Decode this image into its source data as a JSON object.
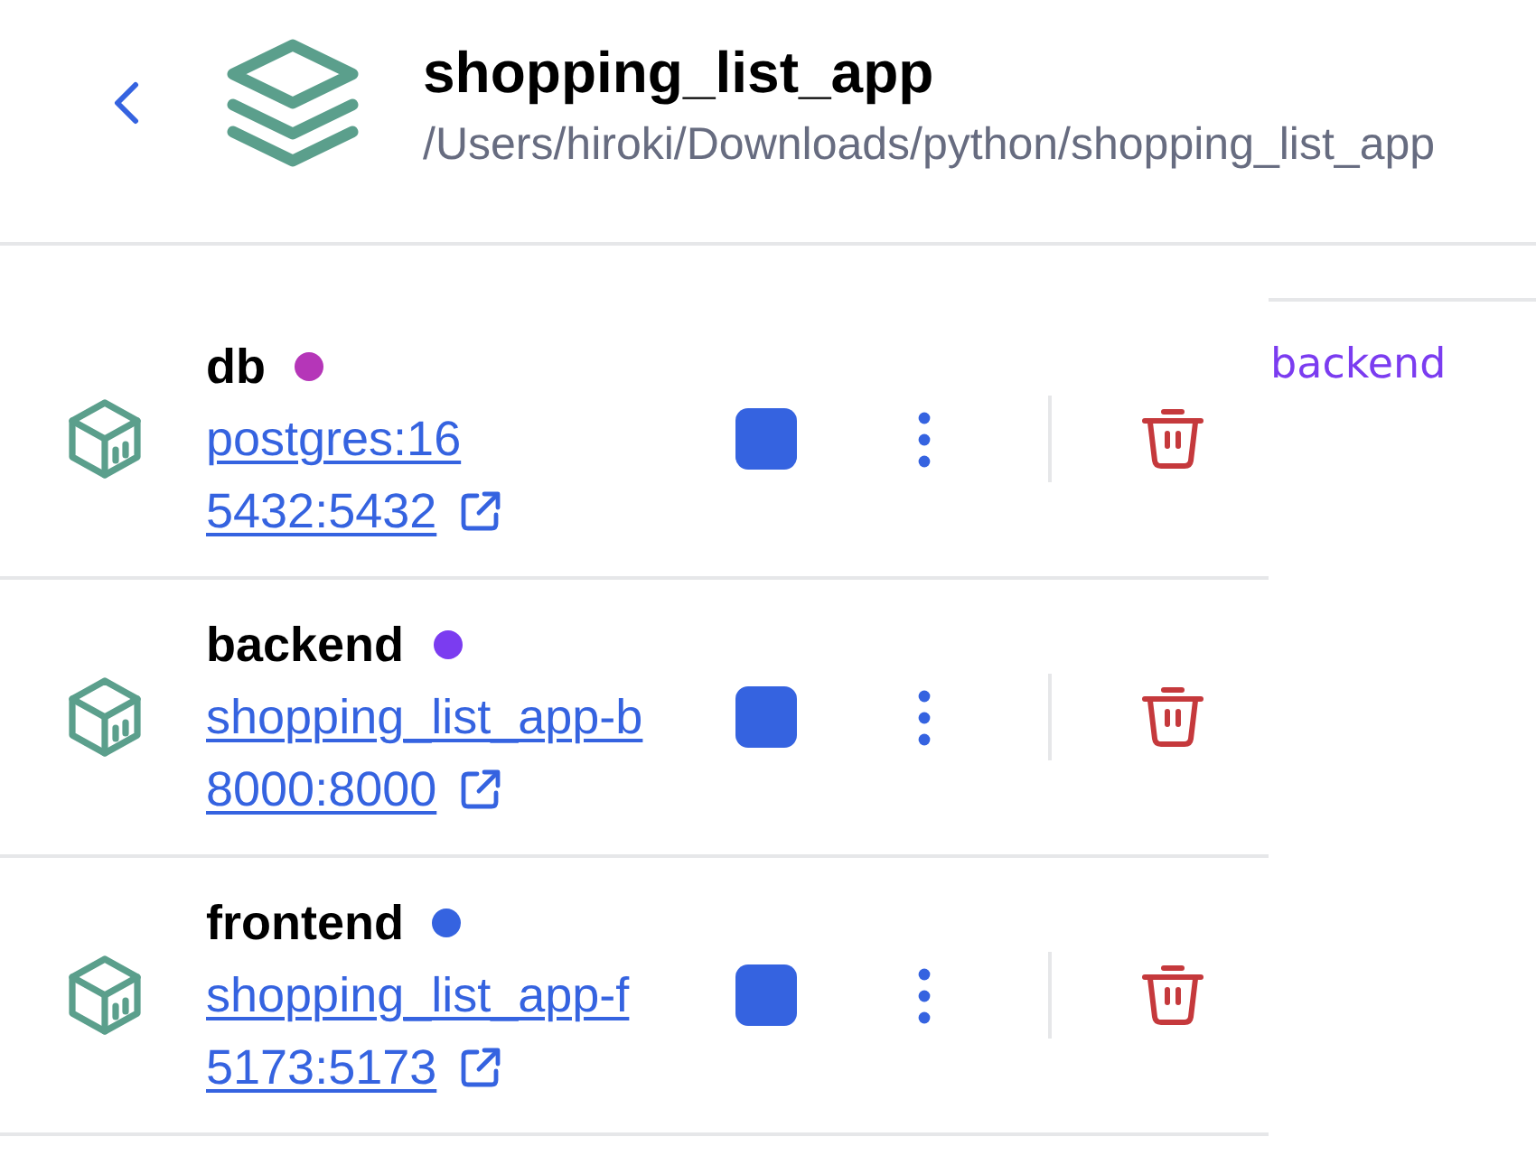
{
  "header": {
    "title": "shopping_list_app",
    "path": "/Users/hiroki/Downloads/python/shopping_list_app"
  },
  "containers": [
    {
      "name": "db",
      "color": "#b536b8",
      "running": true,
      "image": "postgres:16",
      "ports": "5432:5432"
    },
    {
      "name": "backend",
      "color": "#7b3cf0",
      "running": true,
      "image": "shopping_list_app-b",
      "ports": "8000:8000"
    },
    {
      "name": "frontend",
      "color": "#3563e0",
      "running": true,
      "image": "shopping_list_app-f",
      "ports": "5173:5173"
    }
  ],
  "side_panel": {
    "text": "backend"
  }
}
